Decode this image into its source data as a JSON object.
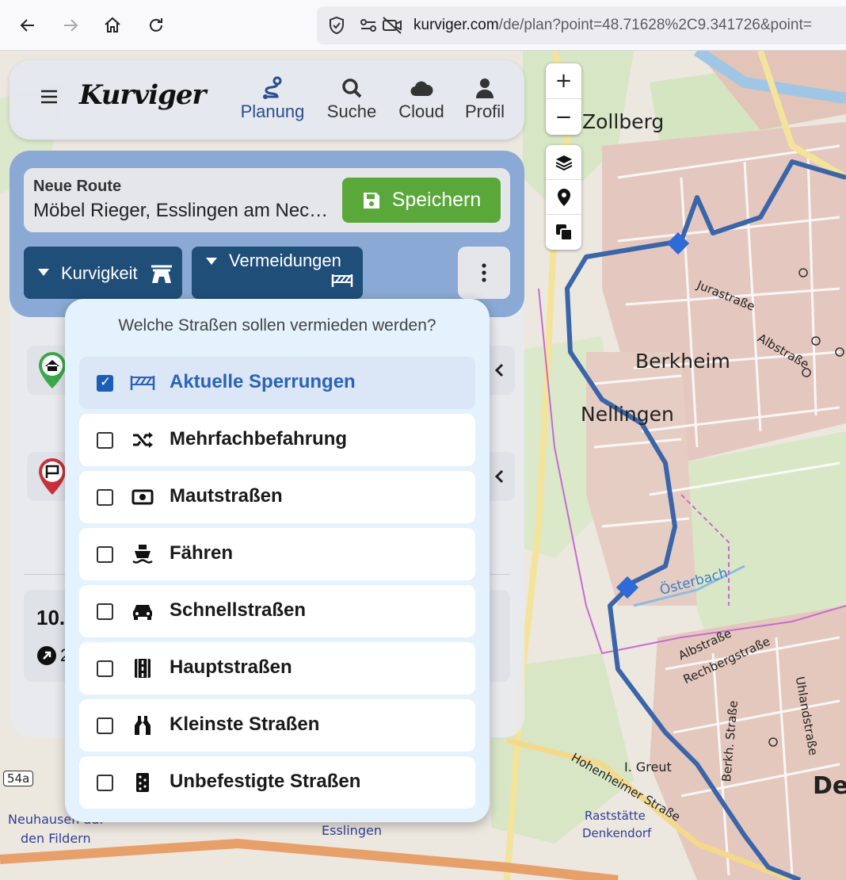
{
  "browser": {
    "url_host": "kurviger.com",
    "url_path": "/de/plan?point=48.71628%2C9.341726&point="
  },
  "app": {
    "logo": "Kurviger",
    "nav": [
      {
        "label": "Planung",
        "icon": "route-icon",
        "active": true
      },
      {
        "label": "Suche",
        "icon": "search-icon",
        "active": false
      },
      {
        "label": "Cloud",
        "icon": "cloud-icon",
        "active": false
      },
      {
        "label": "Profil",
        "icon": "user-icon",
        "active": false
      }
    ]
  },
  "route": {
    "label": "Neue Route",
    "name": "Möbel Rieger, Esslingen am Neckar",
    "save_label": "Speichern",
    "curviness_label": "Kurvigkeit",
    "avoid_label": "Vermeidungen",
    "summary_distance_partial": "10.",
    "summary_sub_partial": "2"
  },
  "map_controls": {
    "zoom_in": "+",
    "zoom_out": "−"
  },
  "map_labels": {
    "zollberg": "Zollberg",
    "berkheim": "Berkheim",
    "nellingen": "Nellingen",
    "osterbach": "Österbach",
    "jurastrasse": "Jurastraße",
    "albstrasse1": "Albstraße",
    "albstrasse2": "Albstraße",
    "rechbergstrasse": "Rechbergstraße",
    "uhlandstrasse": "Uhlandstraße",
    "berkh_strasse": "Berkh. Straße",
    "greut": "I. Greut",
    "hohenheimer": "Hohenheimer Straße",
    "raststaette": "Raststätte",
    "denkendorf": "Denkendorf",
    "neuhausen": "Neuhausen auf",
    "den_fildern": "den Fildern",
    "esslingen": "Esslingen",
    "b54a": "54a",
    "de": "De"
  },
  "avoid_dropdown": {
    "title": "Welche Straßen sollen vermieden werden?",
    "options": [
      {
        "label": "Aktuelle Sperrungen",
        "checked": true,
        "icon": "road-barrier-icon"
      },
      {
        "label": "Mehrfachbefahrung",
        "checked": false,
        "icon": "shuffle-icon"
      },
      {
        "label": "Mautstraßen",
        "checked": false,
        "icon": "money-bill-icon"
      },
      {
        "label": "Fähren",
        "checked": false,
        "icon": "ferry-icon"
      },
      {
        "label": "Schnellstraßen",
        "checked": false,
        "icon": "car-icon"
      },
      {
        "label": "Hauptstraßen",
        "checked": false,
        "icon": "main-road-icon"
      },
      {
        "label": "Kleinste Straßen",
        "checked": false,
        "icon": "narrow-road-icon"
      },
      {
        "label": "Unbefestigte Straßen",
        "checked": false,
        "icon": "dice-icon"
      }
    ]
  },
  "colors": {
    "accent_blue": "#2a4d8f",
    "route_blue": "#3a65a8",
    "save_green": "#5aa83a",
    "pill_dark": "#1f4e79"
  }
}
